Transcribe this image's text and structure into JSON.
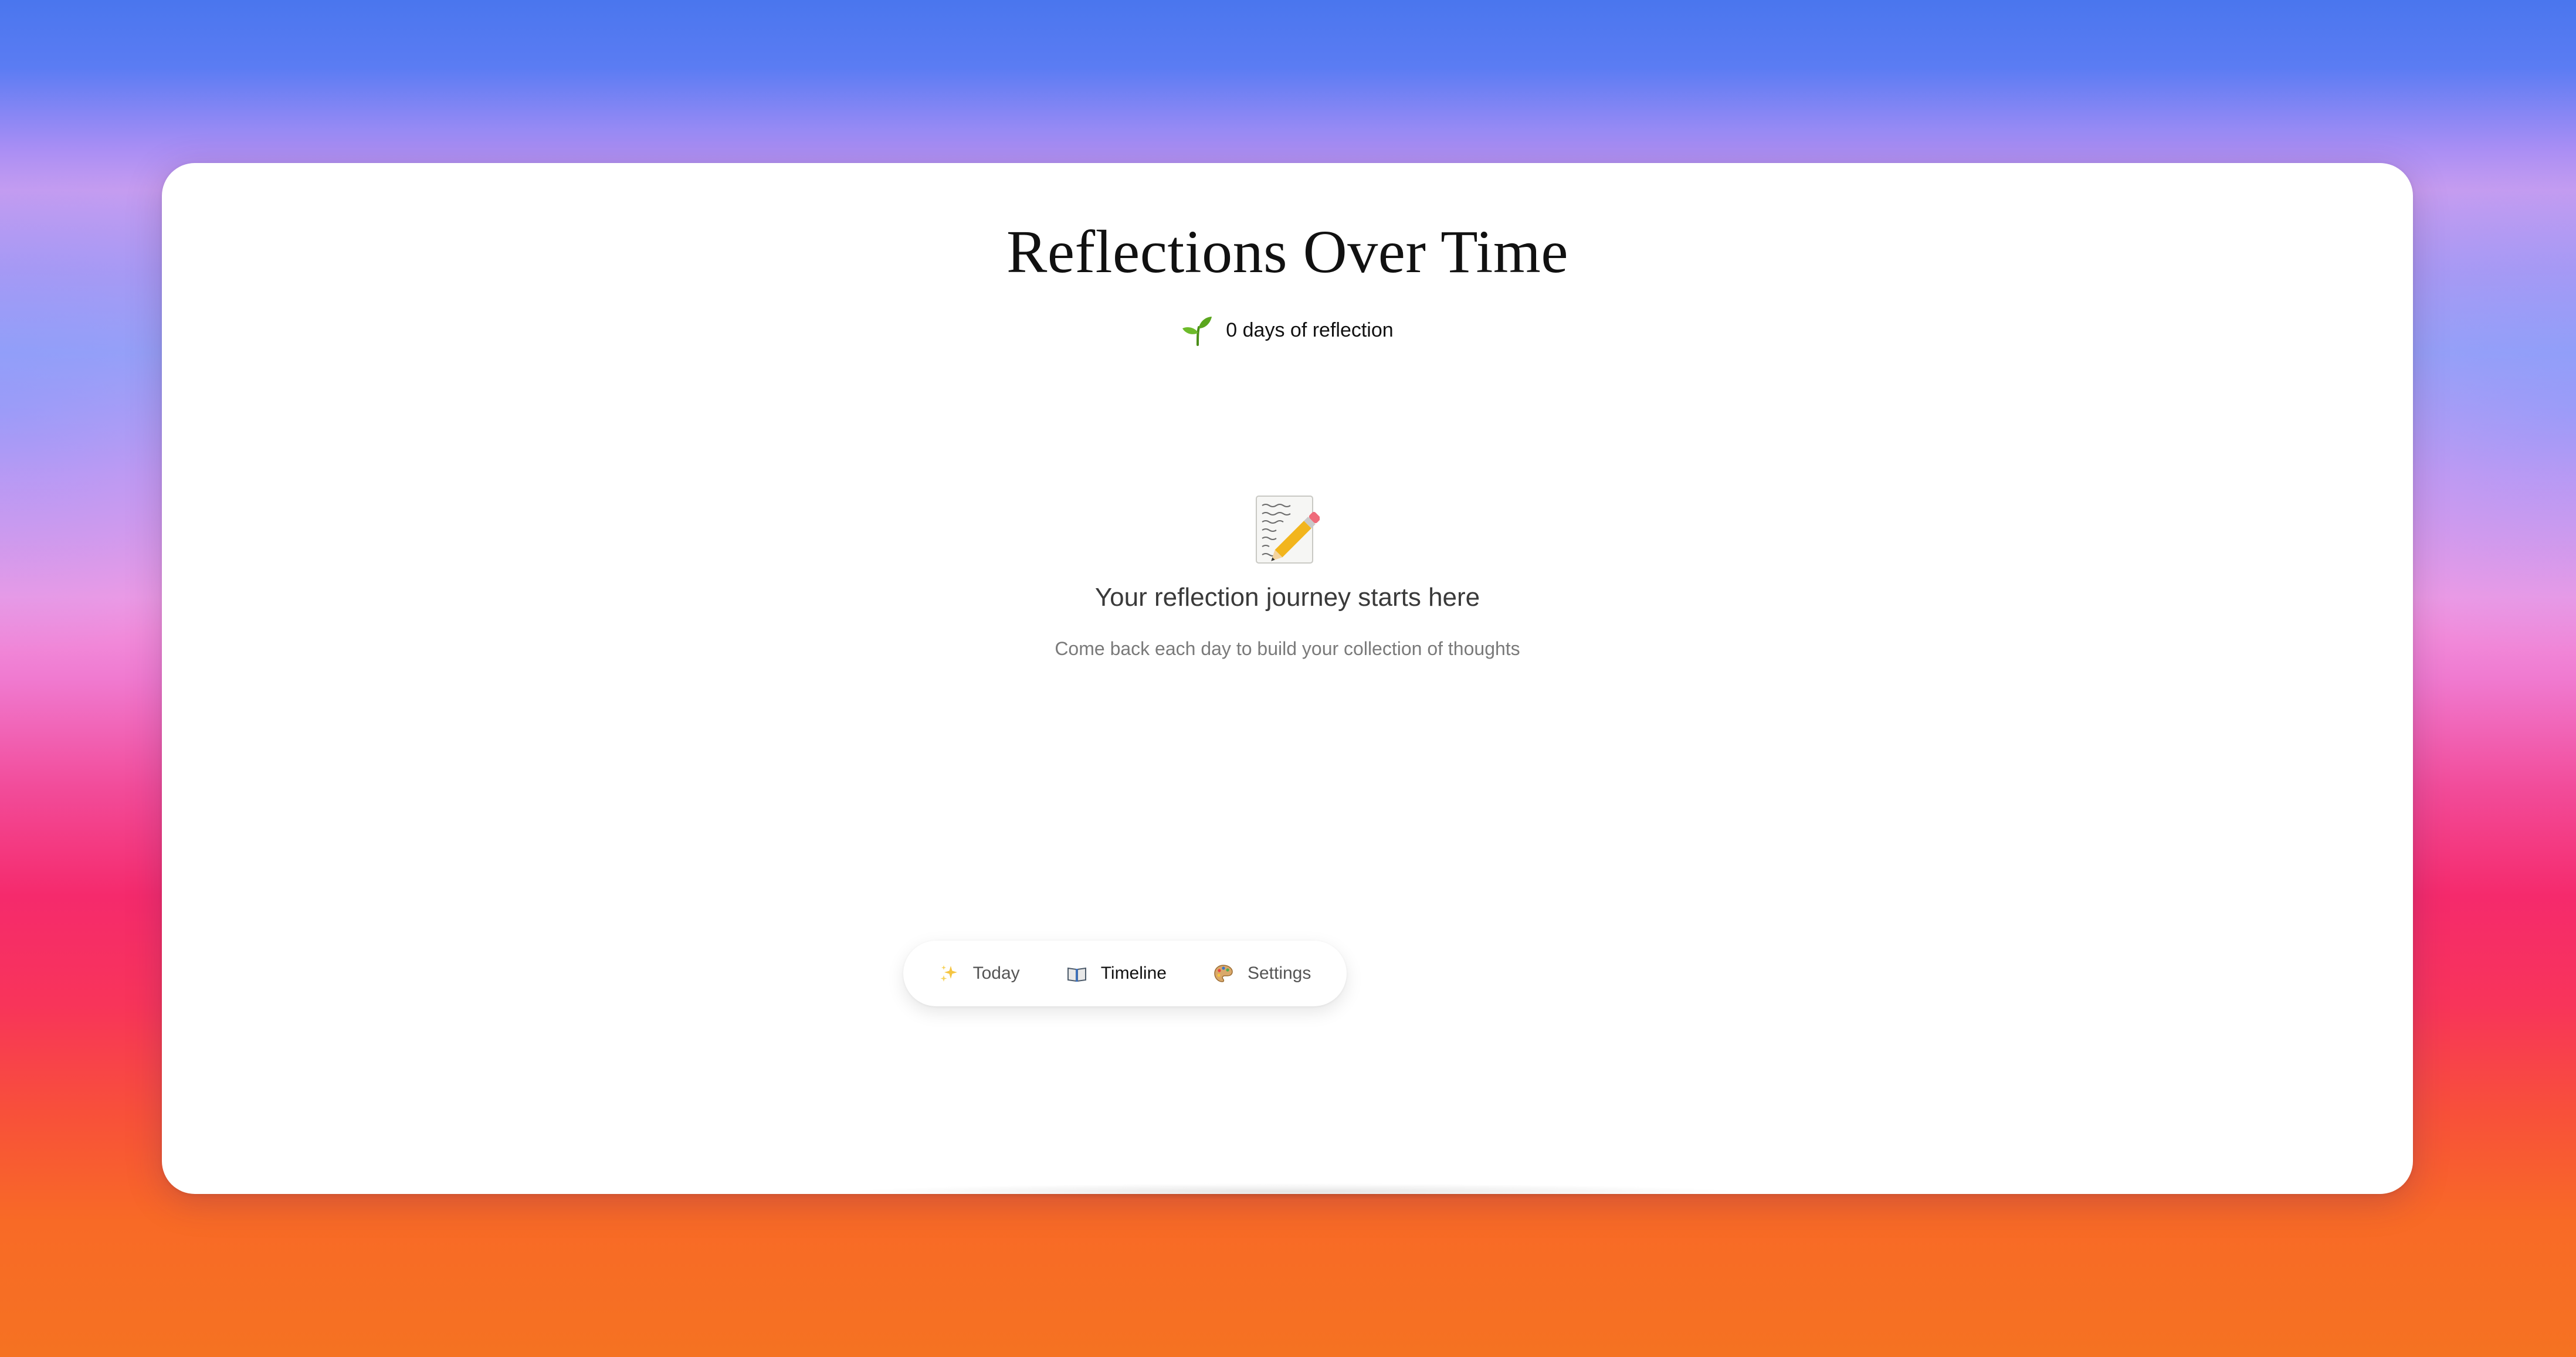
{
  "page": {
    "title": "Reflections Over Time",
    "streak_text": "0 days of reflection"
  },
  "empty_state": {
    "icon": "memo-icon",
    "title": "Your reflection journey starts here",
    "subtitle": "Come back each day to build your collection of thoughts"
  },
  "nav": {
    "items": [
      {
        "label": "Today",
        "icon": "sparkles-icon",
        "active": false
      },
      {
        "label": "Timeline",
        "icon": "open-book-icon",
        "active": true
      },
      {
        "label": "Settings",
        "icon": "palette-icon",
        "active": false
      }
    ]
  },
  "colors": {
    "card": "#ffffff",
    "title_text": "#111111",
    "muted_text": "#7a7a7a",
    "sprout_green": "#5aa61e"
  }
}
